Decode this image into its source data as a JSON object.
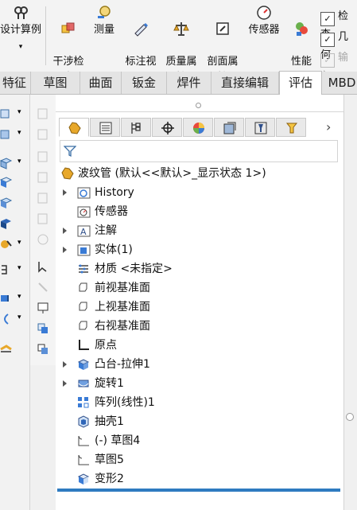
{
  "ribbon": {
    "design_calc": "设计算例",
    "buttons": [
      {
        "label": "干涉检\n查",
        "icon": "interference-icon"
      },
      {
        "label": "测量",
        "icon": "measure-icon"
      },
      {
        "label": "标注视\n图",
        "icon": "annotation-view-icon"
      },
      {
        "label": "质量属\n性",
        "icon": "mass-properties-icon"
      },
      {
        "label": "剖面属\n性",
        "icon": "section-properties-icon"
      },
      {
        "label": "传感器",
        "icon": "sensor-icon"
      },
      {
        "label": "性能\n评估",
        "icon": "performance-icon"
      }
    ],
    "right_items": [
      {
        "label": "检查",
        "dim": false
      },
      {
        "label": "几何",
        "dim": false
      },
      {
        "label": "输入",
        "dim": true
      }
    ]
  },
  "tabs": {
    "items": [
      "特征",
      "草图",
      "曲面",
      "钣金",
      "焊件",
      "直接编辑",
      "评估",
      "MBD"
    ],
    "active_index": 6
  },
  "feature_manager": {
    "root": "波纹管  (默认<<默认>_显示状态 1>)",
    "items": [
      {
        "label": "History",
        "icon": "history-folder-icon",
        "expand": true
      },
      {
        "label": "传感器",
        "icon": "sensor-folder-icon",
        "expand": false
      },
      {
        "label": "注解",
        "icon": "annotations-icon",
        "expand": true
      },
      {
        "label": "实体(1)",
        "icon": "solid-bodies-icon",
        "expand": true
      },
      {
        "label": "材质 <未指定>",
        "icon": "material-icon",
        "expand": false
      },
      {
        "label": "前视基准面",
        "icon": "plane-icon",
        "expand": false
      },
      {
        "label": "上视基准面",
        "icon": "plane-icon",
        "expand": false
      },
      {
        "label": "右视基准面",
        "icon": "plane-icon",
        "expand": false
      },
      {
        "label": "原点",
        "icon": "origin-icon",
        "expand": false
      },
      {
        "label": "凸台-拉伸1",
        "icon": "extrude-icon",
        "expand": true
      },
      {
        "label": "旋转1",
        "icon": "revolve-icon",
        "expand": true
      },
      {
        "label": "阵列(线性)1",
        "icon": "linear-pattern-icon",
        "expand": false
      },
      {
        "label": "抽壳1",
        "icon": "shell-icon",
        "expand": false
      },
      {
        "label": "(-) 草图4",
        "icon": "sketch-icon",
        "expand": false
      },
      {
        "label": "草图5",
        "icon": "sketch-icon",
        "expand": false
      },
      {
        "label": "变形2",
        "icon": "deform-icon",
        "expand": false
      }
    ]
  },
  "colors": {
    "accent": "#2e7bc0",
    "feature_yellow": "#e8a82a"
  }
}
